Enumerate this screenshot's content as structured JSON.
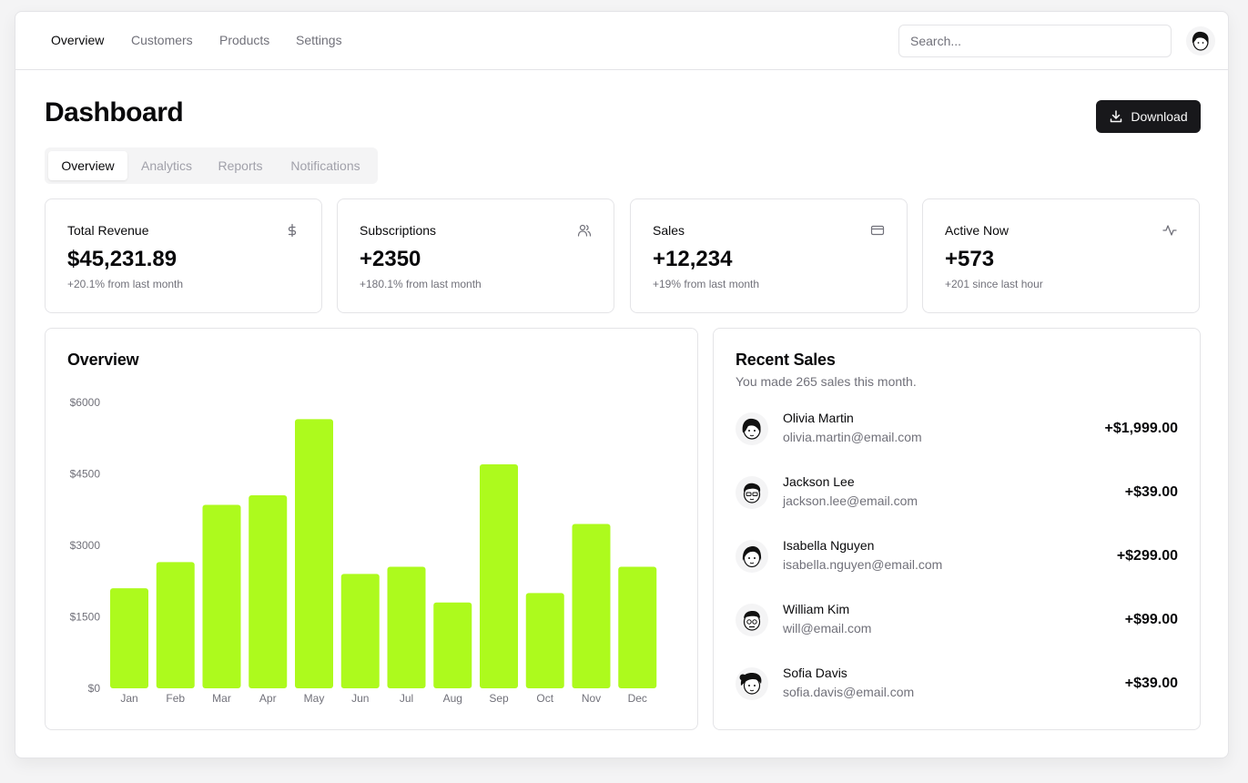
{
  "nav": {
    "links": [
      "Overview",
      "Customers",
      "Products",
      "Settings"
    ],
    "search_placeholder": "Search..."
  },
  "header": {
    "title": "Dashboard",
    "download_label": "Download"
  },
  "tabs": [
    "Overview",
    "Analytics",
    "Reports",
    "Notifications"
  ],
  "stats": [
    {
      "label": "Total Revenue",
      "value": "$45,231.89",
      "sub": "+20.1% from last month",
      "icon": "dollar-icon"
    },
    {
      "label": "Subscriptions",
      "value": "+2350",
      "sub": "+180.1% from last month",
      "icon": "users-icon"
    },
    {
      "label": "Sales",
      "value": "+12,234",
      "sub": "+19% from last month",
      "icon": "credit-card-icon"
    },
    {
      "label": "Active Now",
      "value": "+573",
      "sub": "+201 since last hour",
      "icon": "activity-icon"
    }
  ],
  "overview": {
    "title": "Overview"
  },
  "chart_data": {
    "type": "bar",
    "categories": [
      "Jan",
      "Feb",
      "Mar",
      "Apr",
      "May",
      "Jun",
      "Jul",
      "Aug",
      "Sep",
      "Oct",
      "Nov",
      "Dec"
    ],
    "values": [
      2100,
      2650,
      3850,
      4050,
      5650,
      2400,
      2550,
      1800,
      4700,
      2000,
      3450,
      2550
    ],
    "yticks": [
      "$0",
      "$1500",
      "$3000",
      "$4500",
      "$6000"
    ],
    "ylim": [
      0,
      6000
    ],
    "color": "#adfa1d",
    "grid": false
  },
  "recent_sales": {
    "title": "Recent Sales",
    "subtitle": "You made 265 sales this month.",
    "items": [
      {
        "name": "Olivia Martin",
        "email": "olivia.martin@email.com",
        "amount": "+$1,999.00"
      },
      {
        "name": "Jackson Lee",
        "email": "jackson.lee@email.com",
        "amount": "+$39.00"
      },
      {
        "name": "Isabella Nguyen",
        "email": "isabella.nguyen@email.com",
        "amount": "+$299.00"
      },
      {
        "name": "William Kim",
        "email": "will@email.com",
        "amount": "+$99.00"
      },
      {
        "name": "Sofia Davis",
        "email": "sofia.davis@email.com",
        "amount": "+$39.00"
      }
    ]
  }
}
